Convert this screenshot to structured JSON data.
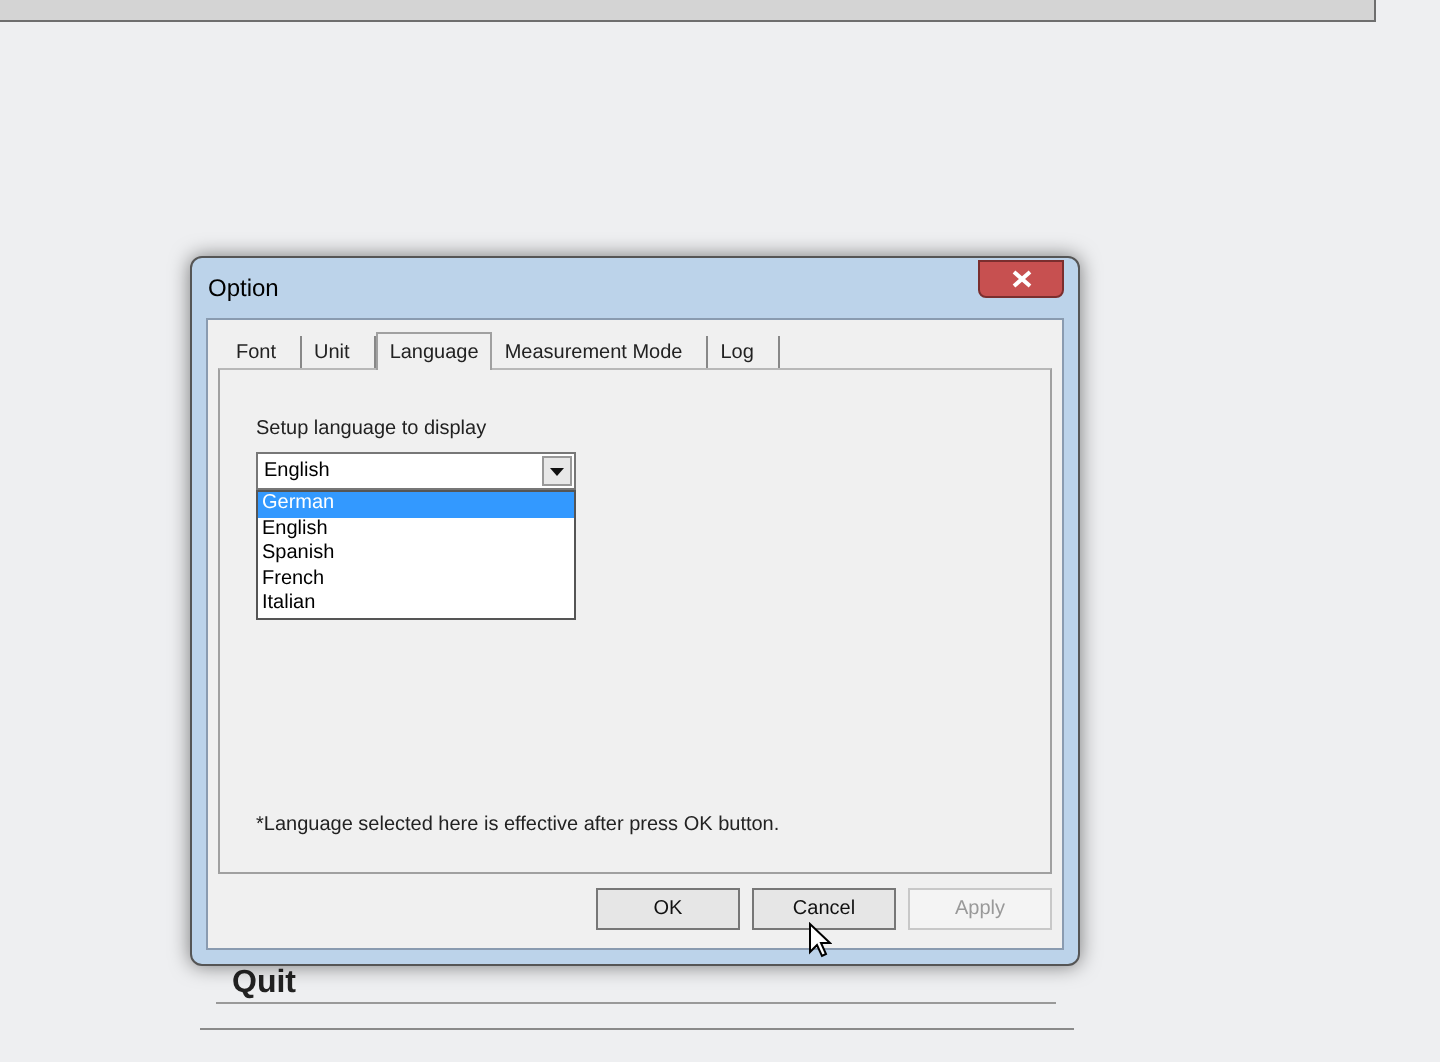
{
  "background": {
    "button": "Quit"
  },
  "dialog": {
    "title": "Option",
    "tabs": [
      {
        "label": "Font",
        "selected": false
      },
      {
        "label": "Unit",
        "selected": false
      },
      {
        "label": "Language",
        "selected": true
      },
      {
        "label": "Measurement Mode",
        "selected": false
      },
      {
        "label": "Log",
        "selected": false
      }
    ],
    "prompt": "Setup language to display",
    "combo": {
      "value": "English",
      "expanded": true
    },
    "options": [
      {
        "label": "German",
        "selected": true
      },
      {
        "label": "English",
        "selected": false
      },
      {
        "label": "Spanish",
        "selected": false
      },
      {
        "label": "French",
        "selected": false
      },
      {
        "label": "Italian",
        "selected": false
      }
    ],
    "note": "*Language selected here is effective after press OK button.",
    "buttons": [
      {
        "label": "OK",
        "disabled": false
      },
      {
        "label": "Cancel",
        "disabled": false
      },
      {
        "label": "Apply",
        "disabled": true
      }
    ]
  }
}
